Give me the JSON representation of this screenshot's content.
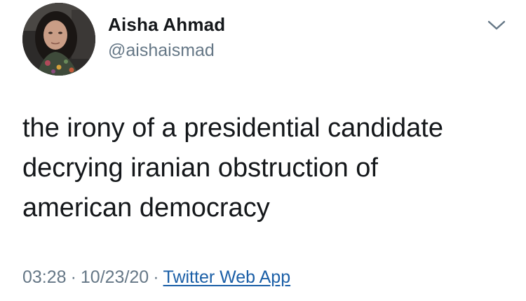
{
  "tweet": {
    "display_name": "Aisha Ahmad",
    "handle": "@aishaismad",
    "text": "the irony of a presidential candidate\ndecrying iranian obstruction of\namerican democracy",
    "time": "03:28",
    "date": "10/23/20",
    "separator": "·",
    "source": "Twitter Web App",
    "caret_icon": "chevron-down-icon",
    "avatar_icon": "avatar-photo"
  },
  "colors": {
    "text": "#14171a",
    "secondary": "#657786",
    "link": "#1b5fa7"
  }
}
